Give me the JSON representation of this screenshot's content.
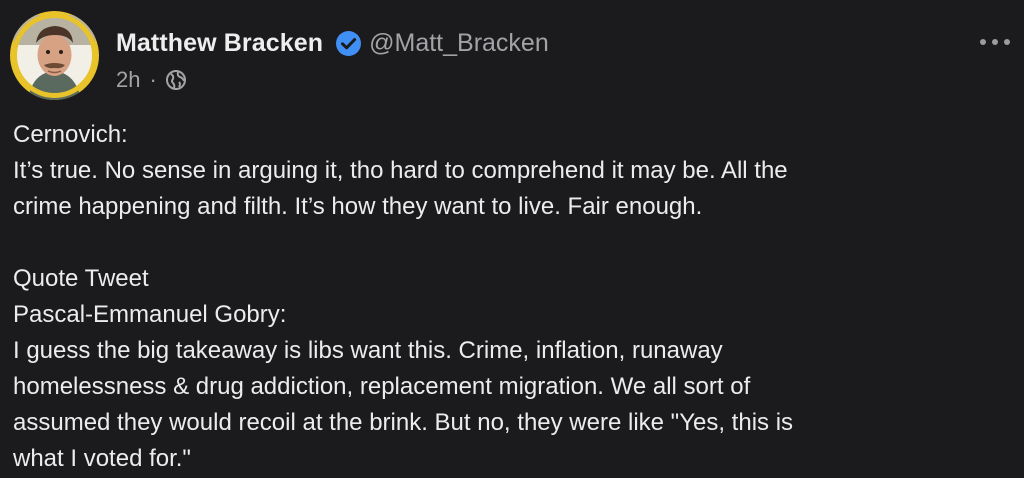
{
  "author": {
    "display_name": "Matthew Bracken",
    "handle": "@Matt_Bracken",
    "verified": true
  },
  "meta": {
    "time": "2h",
    "separator": "·",
    "visibility_icon": "globe-icon"
  },
  "menu_icon": "more-icon",
  "post": {
    "lines": [
      "Cernovich:",
      "It’s true. No sense in arguing it, tho hard to comprehend it may be. All the",
      "crime happening and filth. It’s how they want to live. Fair enough.",
      "Quote Tweet",
      "Pascal-Emmanuel Gobry:",
      "I guess the big takeaway is libs want this. Crime, inflation, runaway",
      "homelessness & drug addiction, replacement migration. We all sort of",
      "assumed they would recoil at the brink. But no, they were like \"Yes, this is",
      "what I voted for.\""
    ]
  },
  "colors": {
    "background": "#1b1b1d",
    "avatar_ring": "#e8c32a",
    "verified_badge": "#3f8ff5",
    "muted_text": "#a3a3a7",
    "body_text": "#ececed"
  }
}
